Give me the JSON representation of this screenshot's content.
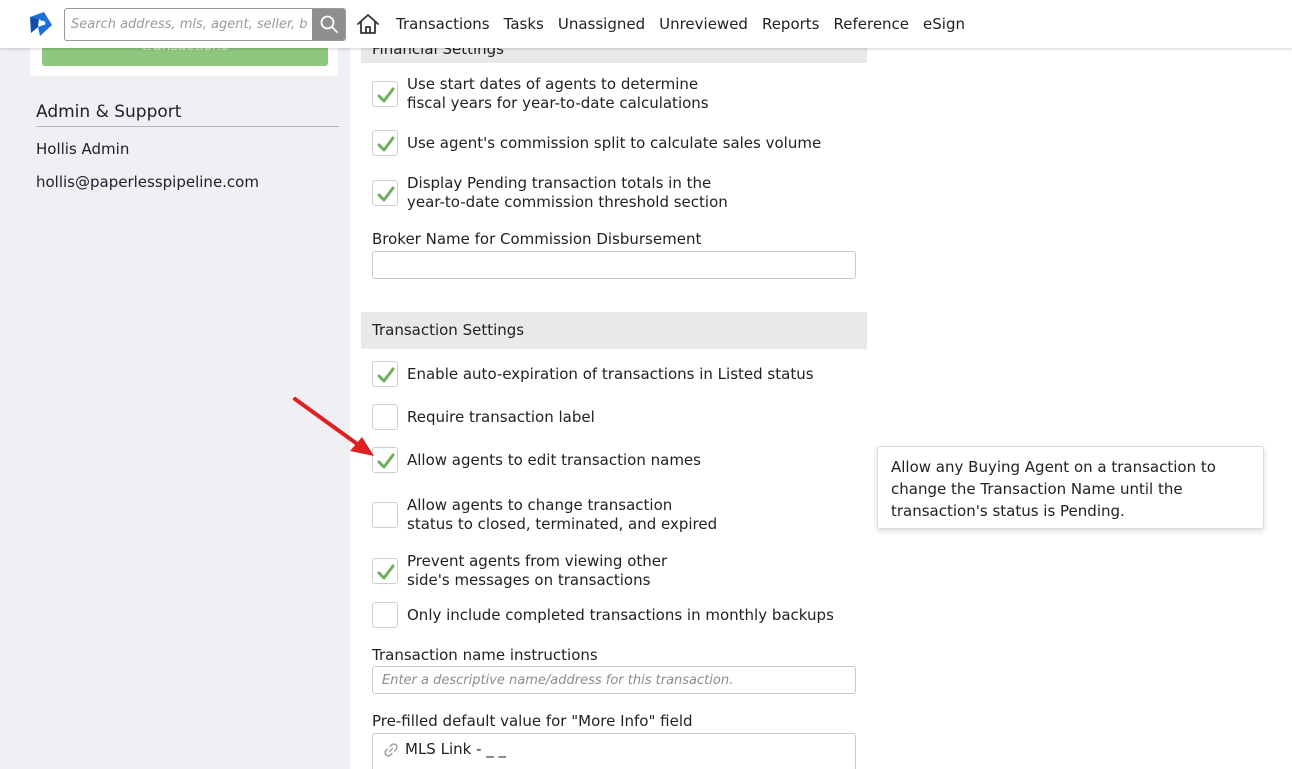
{
  "topbar": {
    "search_placeholder": "Search address, mls, agent, seller, buyer",
    "nav": [
      "Transactions",
      "Tasks",
      "Unassigned",
      "Unreviewed",
      "Reports",
      "Reference",
      "eSign"
    ]
  },
  "sidebar": {
    "button_label": "transactions",
    "admin_title": "Admin & Support",
    "admin_name": "Hollis Admin",
    "admin_email": "hollis@paperlesspipeline.com"
  },
  "financial": {
    "heading": "Financial Settings",
    "options": [
      {
        "label_line1": "Use start dates of agents to determine",
        "label_line2": "fiscal years for year-to-date calculations",
        "checked": true
      },
      {
        "label_line1": "Use agent's commission split to calculate sales volume",
        "label_line2": "",
        "checked": true
      },
      {
        "label_line1": "Display Pending transaction totals in the",
        "label_line2": "year-to-date commission threshold section",
        "checked": true
      }
    ],
    "broker_label": "Broker Name for Commission Disbursement",
    "broker_value": ""
  },
  "transaction": {
    "heading": "Transaction Settings",
    "options": [
      {
        "label_line1": "Enable auto-expiration of transactions in Listed status",
        "label_line2": "",
        "checked": true
      },
      {
        "label_line1": "Require transaction label",
        "label_line2": "",
        "checked": false
      },
      {
        "label_line1": "Allow agents to edit transaction names",
        "label_line2": "",
        "checked": true
      },
      {
        "label_line1": "Allow agents to change transaction",
        "label_line2": "status to closed, terminated, and expired",
        "checked": false
      },
      {
        "label_line1": "Prevent agents from viewing other",
        "label_line2": "side's messages on transactions",
        "checked": true
      },
      {
        "label_line1": "Only include completed transactions in monthly backups",
        "label_line2": "",
        "checked": false
      }
    ],
    "name_instructions_label": "Transaction name instructions",
    "name_instructions_placeholder": "Enter a descriptive name/address for this transaction.",
    "more_info_label": "Pre-filled default value for \"More Info\" field",
    "more_info_value": "MLS Link - _ _"
  },
  "tooltip": {
    "text": "Allow any Buying Agent on a transaction to change the Transaction Name until the transaction's status is Pending."
  },
  "colors": {
    "check": "#6fae5f",
    "sidebar_bg": "#efeff4",
    "section_bg": "#e9e9e9",
    "green_button": "#8ec77e",
    "arrow": "#e02020"
  }
}
